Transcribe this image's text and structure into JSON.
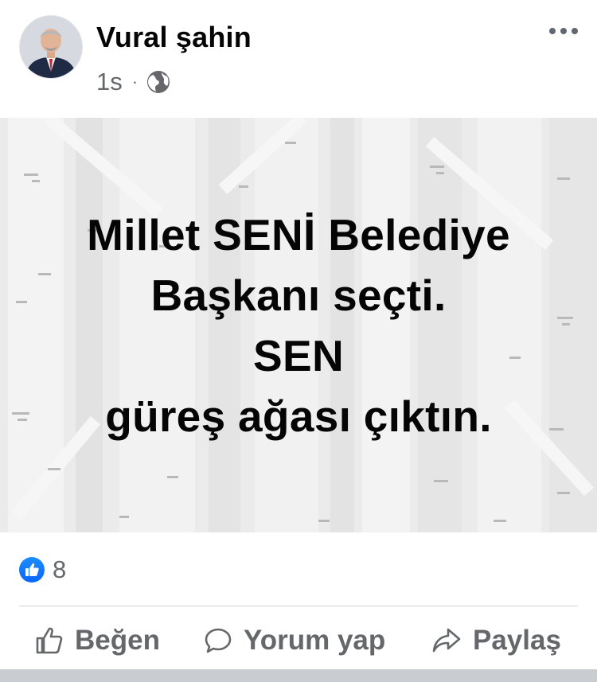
{
  "post": {
    "author": {
      "name": "Vural şahin",
      "avatar_icon": "profile-photo-man-suit"
    },
    "time": "1s",
    "separator": "·",
    "privacy_icon": "globe-icon",
    "more_icon": "more-horizontal-icon",
    "background_style": "gray birch-tree pattern",
    "text_lines": [
      "Millet SENİ Belediye",
      "Başkanı seçti.",
      "SEN",
      "güreş ağası çıktın."
    ],
    "reactions": {
      "icon": "like-icon",
      "count": "8",
      "color": "#1877f2"
    },
    "actions": {
      "like": {
        "label": "Beğen",
        "icon": "thumbs-up-icon"
      },
      "comment": {
        "label": "Yorum yap",
        "icon": "comment-icon"
      },
      "share": {
        "label": "Paylaş",
        "icon": "share-icon"
      }
    }
  }
}
